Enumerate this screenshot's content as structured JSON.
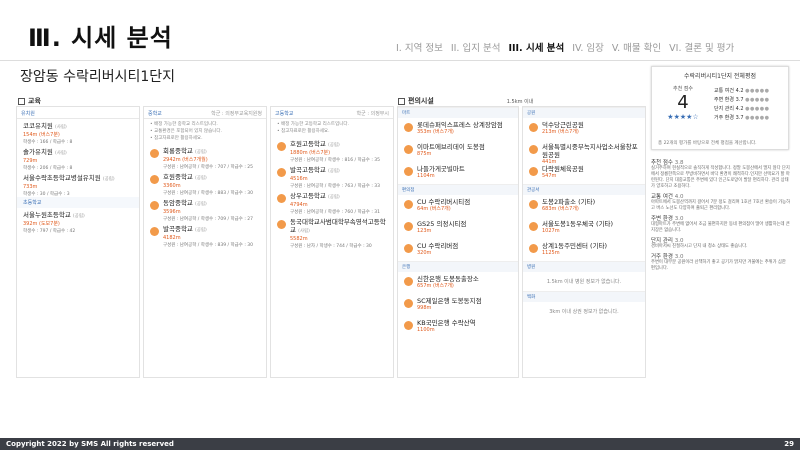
{
  "header": {
    "title": "Ⅲ. 시세 분석",
    "subtitle": "장암동 수락리버시티1단지"
  },
  "nav": [
    "I. 지역 정보",
    "II. 입지 분석",
    "III. 시세 분석",
    "IV. 임장",
    "V. 매물 확인",
    "VI. 결론 및 평가"
  ],
  "education": {
    "heading": "교육",
    "kindergarten": {
      "label": "유치원",
      "items": [
        {
          "name": "코코유치원",
          "type": "(사립)",
          "dist": "154m (버스7분)",
          "meta": "학생수 : 166 / 학급수 : 8"
        },
        {
          "name": "솔가유치원",
          "type": "(사립)",
          "dist": "729m",
          "meta": "학생수 : 206 / 학급수 : 8"
        },
        {
          "name": "서울수락초등학교병설유치원",
          "type": "(공립)",
          "dist": "733m",
          "meta": "학생수 : 30 / 학급수 : 3"
        }
      ],
      "label2": "초등학교",
      "items2": [
        {
          "name": "서울누원초등학교",
          "type": "(공립)",
          "dist": "392m (도보7분)",
          "meta": "학생수 : 797 / 학급수 : 42"
        }
      ]
    },
    "middle": {
      "label": "중학교",
      "right": "학군 : 의정부교육지원청",
      "notes": [
        "배정 가능한 중학교 리스트입니다.",
        "교통환경은 포함되어 있지 않습니다.",
        "참고자료로만 활용하세요."
      ],
      "items": [
        {
          "name": "회룡중학교",
          "type": "(공립)",
          "dist": "2942m (버스7개월)",
          "meta": "구성원 : 남여공학 / 학생수 : 707 / 학급수 : 25"
        },
        {
          "name": "호원중학교",
          "type": "(공립)",
          "dist": "3360m",
          "meta": "구성원 : 남여공학 / 학생수 : 883 / 학급수 : 30"
        },
        {
          "name": "동암중학교",
          "type": "(공립)",
          "dist": "3596m",
          "meta": "구성원 : 남여공학 / 학생수 : 709 / 학급수 : 27"
        },
        {
          "name": "발곡중학교",
          "type": "(공립)",
          "dist": "4182m",
          "meta": "구성원 : 남여공학 / 학생수 : 839 / 학급수 : 30"
        }
      ]
    },
    "high": {
      "label": "고등학교",
      "right": "학군 : 의정부시",
      "notes": [
        "배정 가능한 고등학교 리스트입니다.",
        "참고자료로만 활용하세요."
      ],
      "items": [
        {
          "name": "호원고등학교",
          "type": "(공립)",
          "dist": "1880m (버스7분)",
          "meta": "구성원 : 남여공학 / 학생수 : 816 / 학급수 : 35"
        },
        {
          "name": "발곡고등학교",
          "type": "(공립)",
          "dist": "4516m",
          "meta": "구성원 : 남여공학 / 학생수 : 763 / 학급수 : 33"
        },
        {
          "name": "상우고등학교",
          "type": "(공립)",
          "dist": "4794m",
          "meta": "구성원 : 남여공학 / 학생수 : 760 / 학급수 : 31"
        },
        {
          "name": "동국대학교사범대학부속영석고등학교",
          "type": "(사립)",
          "dist": "5582m",
          "meta": "구성원 : 남자 / 학생수 : 744 / 학급수 : 30"
        }
      ]
    }
  },
  "facilities": {
    "heading": "편의시설",
    "range": "1.5km 이내",
    "mart_label": "마트",
    "mart": [
      {
        "name": "롯데슈퍼익스프레스 상계장암점",
        "dist": "353m (버스7개)"
      },
      {
        "name": "이마트에브리데이 도봉점",
        "dist": "875m"
      },
      {
        "name": "나들가게굿빌마트",
        "dist": "1104m"
      }
    ],
    "conv_label": "편의점",
    "conv": [
      {
        "name": "CU 수락리버시티점",
        "dist": "64m (버스7개)"
      },
      {
        "name": "GS25 의정시티점",
        "dist": "123m"
      },
      {
        "name": "CU 수락리버점",
        "dist": "320m"
      }
    ],
    "bank_label": "은행",
    "bank": [
      {
        "name": "신한은행 도봉동출장소",
        "dist": "657m (버스7개)"
      },
      {
        "name": "SC제일은행 도봉동지점",
        "dist": "998m"
      },
      {
        "name": "KB국민은행 수락산역",
        "dist": "1100m"
      }
    ],
    "park_label": "공원",
    "park": [
      {
        "name": "덕수당근린공원",
        "dist": "213m (버스7개)"
      },
      {
        "name": "서울특별시중부녹지사업소서울창포원공원",
        "dist": "441m"
      },
      {
        "name": "다락원체육공원",
        "dist": "547m"
      }
    ],
    "public_label": "관공서",
    "public": [
      {
        "name": "도봉2파출소 (기타)",
        "dist": "683m (버스7개)"
      },
      {
        "name": "서울도봉1동우체국 (기타)",
        "dist": "1027m"
      },
      {
        "name": "상계1동주민센터 (기타)",
        "dist": "1125m"
      }
    ],
    "hospital_label": "병원",
    "hospital_empty": "1.5km 이내 병원 정보가 없습니다.",
    "dept_label": "백화",
    "dept_empty": "3km 이내 상권 정보가 없습니다."
  },
  "rating": {
    "title": "수락리버시티1단지 전체평점",
    "total_label": "추천 점수",
    "total": "4",
    "stars": "★★★★☆",
    "rows": [
      {
        "label": "교통 여건",
        "score": "4.2"
      },
      {
        "label": "주변 환경",
        "score": "3.7"
      },
      {
        "label": "단지 관리",
        "score": "4.2"
      },
      {
        "label": "거주 환경",
        "score": "3.7"
      }
    ],
    "footer": "총 22개의 평가를 바탕으로 전체 평점을 계산합니다."
  },
  "reviews": [
    {
      "title": "추천 점수",
      "score": "3.8",
      "text": "실거주하며 현실적으로 솔직하게 작성합니다. 정말 도봉산에서 멀지 않다 단지에서 정릉한쪽으로 무방비하면서 바닥 환경이 쾌적하다.인지만 선택요가 할 마련된다. 단지 대중교통은 주변에 있다 인근도로망이 발달 편리하다. 관리 상태가 양호하고 조용하다."
    },
    {
      "title": "교통 여건",
      "score": "4.0",
      "text": "아파트에서 도봉산역까지 걸어서 7분 정도 걸리며 1호선 7호선 환승이 가능하고 버스 노선도 다양하여 출퇴근 편리합니다."
    },
    {
      "title": "주변 환경",
      "score": "3.0",
      "text": "대형마트가 주변에 없어서 조금 불편하지만 동네 편의점이 많아 생활하는데 큰 지장은 없습니다."
    },
    {
      "title": "단지 관리",
      "score": "3.0",
      "text": "경비아저씨 친절하시고 단지 내 청소 상태도 좋습니다."
    },
    {
      "title": "거주 환경",
      "score": "3.0",
      "text": "주변이 대부분 공원이라 산책하기 좋고 공기가 맑지만 겨울에는 추위가 심한 편입니다."
    }
  ],
  "footer": {
    "copyright": "Copyright 2022 by SMS All rights reserved",
    "page": "29"
  }
}
